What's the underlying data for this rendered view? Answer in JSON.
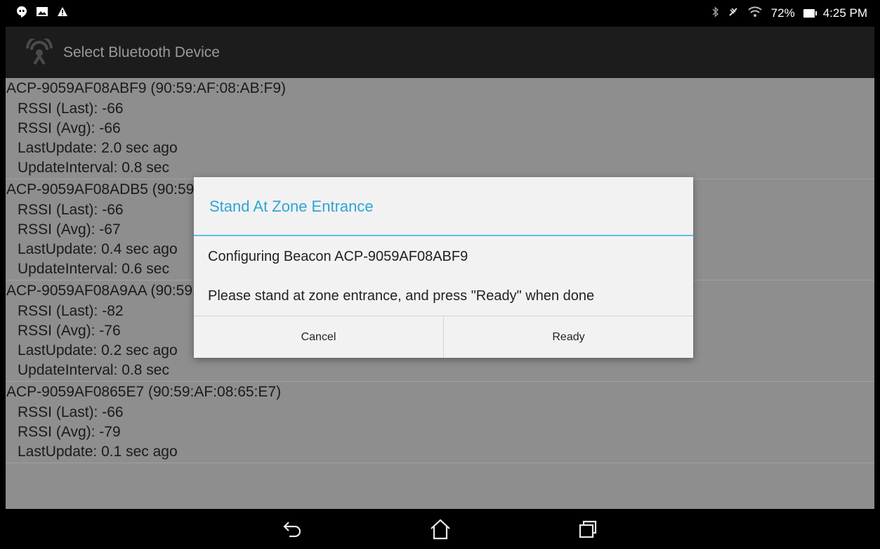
{
  "status_bar": {
    "left_icons": [
      "hangouts-icon",
      "gallery-icon",
      "warning-icon"
    ],
    "right_icons": [
      "bluetooth-icon",
      "silent-icon",
      "wifi-icon"
    ],
    "battery": "72%",
    "time": "4:25 PM"
  },
  "action_bar": {
    "title": "Select Bluetooth Device"
  },
  "devices": [
    {
      "name": "ACP-9059AF08ABF9 (90:59:AF:08:AB:F9)",
      "rssi_last": "RSSI (Last): -66",
      "rssi_avg": "RSSI (Avg): -66",
      "last_update": "LastUpdate: 2.0 sec ago",
      "update_interval": "UpdateInterval: 0.8 sec"
    },
    {
      "name": "ACP-9059AF08ADB5 (90:59:AF:08:AD:B5)",
      "rssi_last": "RSSI (Last): -66",
      "rssi_avg": "RSSI (Avg): -67",
      "last_update": "LastUpdate: 0.4 sec ago",
      "update_interval": "UpdateInterval: 0.6 sec"
    },
    {
      "name": "ACP-9059AF08A9AA (90:59:AF:08:A9:AA)",
      "rssi_last": "RSSI (Last): -82",
      "rssi_avg": "RSSI (Avg): -76",
      "last_update": "LastUpdate: 0.2 sec ago",
      "update_interval": "UpdateInterval: 0.8 sec"
    },
    {
      "name": "ACP-9059AF0865E7 (90:59:AF:08:65:E7)",
      "rssi_last": "RSSI (Last): -66",
      "rssi_avg": "RSSI (Avg): -79",
      "last_update": "LastUpdate: 0.1 sec ago",
      "update_interval": ""
    }
  ],
  "dialog": {
    "title": "Stand At Zone Entrance",
    "message1": "Configuring Beacon ACP-9059AF08ABF9",
    "message2": "Please stand at zone entrance, and press \"Ready\" when done",
    "cancel_label": "Cancel",
    "ready_label": "Ready"
  },
  "nav_bar": {
    "buttons": [
      "back-icon",
      "home-icon",
      "recents-icon"
    ]
  },
  "colors": {
    "accent": "#2fa5d6",
    "list_background": "#8e8e8e",
    "action_bar": "#1c1c1c"
  }
}
